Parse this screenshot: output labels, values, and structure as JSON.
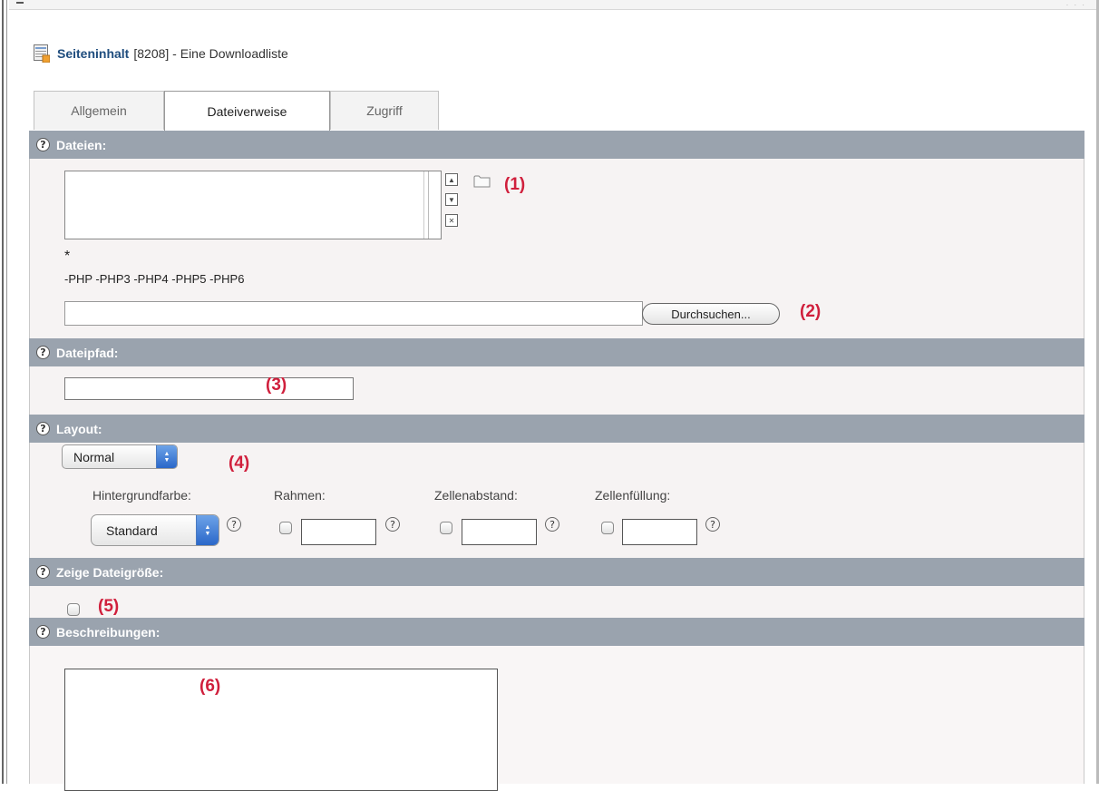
{
  "header": {
    "title_strong": "Seiteninhalt",
    "title_rest": "[8208] - Eine Downloadliste"
  },
  "tabs": [
    {
      "label": "Allgemein",
      "active": false
    },
    {
      "label": "Dateiverweise",
      "active": true
    },
    {
      "label": "Zugriff",
      "active": false
    }
  ],
  "sections": {
    "dateien": {
      "label": "Dateien:",
      "annotation_list": "(1)",
      "asterisk": "*",
      "disallowed": "-PHP -PHP3 -PHP4 -PHP5 -PHP6",
      "browse_label": "Durchsuchen...",
      "annotation_upload": "(2)"
    },
    "dateipfad": {
      "label": "Dateipfad:",
      "annotation": "(3)"
    },
    "layout": {
      "label": "Layout:",
      "layout_value": "Normal",
      "annotation": "(4)",
      "hintergrundfarbe_label": "Hintergrundfarbe:",
      "hintergrundfarbe_value": "Standard",
      "rahmen_label": "Rahmen:",
      "zellenabstand_label": "Zellenabstand:",
      "zellenfuellung_label": "Zellenfüllung:"
    },
    "dateigroesse": {
      "label": "Zeige Dateigröße:",
      "annotation": "(5)"
    },
    "beschreibungen": {
      "label": "Beschreibungen:",
      "annotation": "(6)"
    }
  },
  "icons": {
    "help": "?",
    "move_up": "▲",
    "move_down": "▼",
    "remove": "✕"
  },
  "colors": {
    "section_header_bg": "#9aa3ae",
    "annotation": "#d01f3c",
    "title_link": "#1f4d7e",
    "select_arrow": "#2a67c9"
  }
}
